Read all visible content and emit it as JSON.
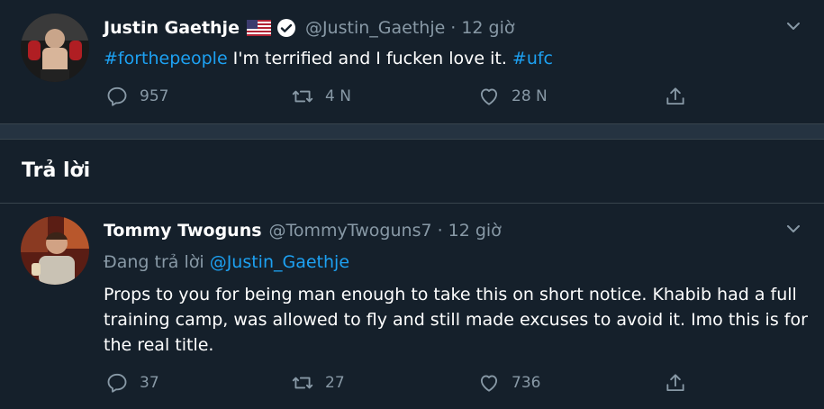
{
  "tweet1": {
    "name": "Justin Gaethje",
    "handle": "@Justin_Gaethje",
    "dot": "·",
    "time": "12 giờ",
    "hashtag1": "#forthepeople",
    "text": " I'm terrified and I fucken love it. ",
    "hashtag2": "#ufc",
    "replies": "957",
    "retweets": "4 N",
    "likes": "28 N"
  },
  "section": {
    "title": "Trả lời"
  },
  "tweet2": {
    "name": "Tommy Twoguns",
    "handle": "@TommyTwoguns7",
    "dot": "·",
    "time": "12 giờ",
    "replying_prefix": "Đang trả lời ",
    "replying_to": "@Justin_Gaethje",
    "text": "Props to you for being man enough to take this on short notice. Khabib had a full training camp, was allowed to fly and still made excuses to avoid it. Imo this is for the real title.",
    "replies": "37",
    "retweets": "27",
    "likes": "736"
  },
  "colors": {
    "background": "#15202b",
    "secondary_text": "#8899a6",
    "accent": "#1da1f2",
    "separator": "#253341"
  },
  "icons": [
    "caret-down-icon",
    "reply-icon",
    "retweet-icon",
    "like-icon",
    "share-icon",
    "verified-badge-icon",
    "us-flag-icon"
  ]
}
